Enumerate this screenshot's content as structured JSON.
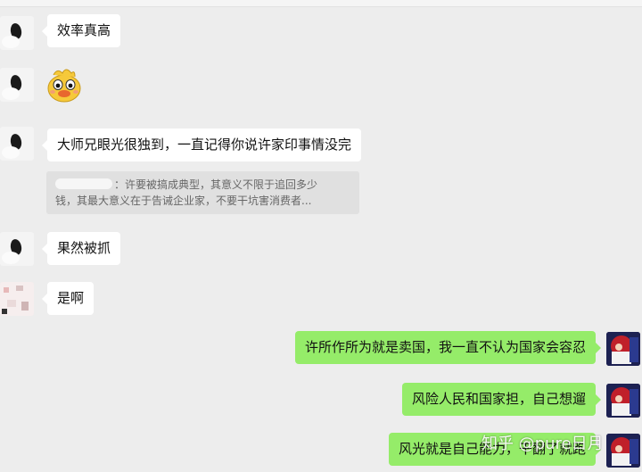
{
  "messages_in": [
    {
      "text": "效率真高"
    },
    {
      "sticker": "yellow-duck-sticker"
    },
    {
      "text": "大师兄眼光很独到，一直记得你说许家印事情没完"
    },
    {
      "text": "果然被抓"
    },
    {
      "text": "是啊"
    }
  ],
  "quote": {
    "line1": "：许要被搞成典型，其意义不限于追回多少",
    "line2": "钱，其最大意义在于告诫企业家，不要干坑害消费者..."
  },
  "messages_out": [
    {
      "text": "许所作所为就是卖国，我一直不认为国家会容忍"
    },
    {
      "text": "风险人民和国家担，自己想遛"
    },
    {
      "text": "风光就是自己能力，干翻了就跑"
    }
  ],
  "watermark": "知乎 @pure日月",
  "colors": {
    "background": "#ededed",
    "incoming_bubble": "#ffffff",
    "outgoing_bubble": "#95ec69",
    "quote_bg": "#e0e0e0"
  }
}
